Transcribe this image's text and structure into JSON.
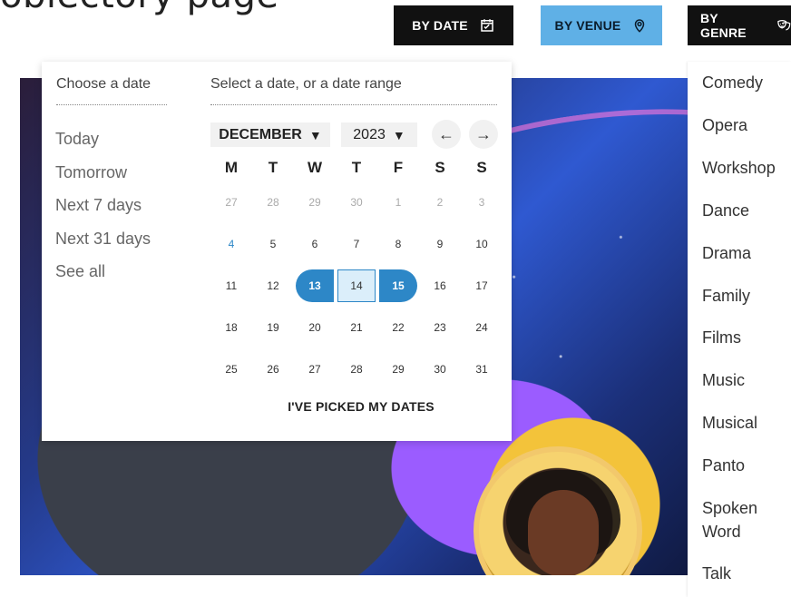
{
  "top_fragment": "oblectory page",
  "filters": {
    "date": {
      "label": "BY DATE",
      "icon": "calendar-icon"
    },
    "venue": {
      "label": "BY VENUE",
      "icon": "location-pin-icon"
    },
    "genre": {
      "label": "BY GENRE",
      "icon": "theatre-masks-icon"
    }
  },
  "date_picker": {
    "choose_title": "Choose a date",
    "select_title": "Select a date, or a date range",
    "quick_options": [
      "Today",
      "Tomorrow",
      "Next 7 days",
      "Next 31 days",
      "See all"
    ],
    "month": "DECEMBER",
    "year": "2023",
    "nav": {
      "prev": "←",
      "next": "→"
    },
    "weekdays": [
      "M",
      "T",
      "W",
      "T",
      "F",
      "S",
      "S"
    ],
    "weeks": [
      [
        {
          "d": "27",
          "s": "muted"
        },
        {
          "d": "28",
          "s": "muted"
        },
        {
          "d": "29",
          "s": "muted"
        },
        {
          "d": "30",
          "s": "muted"
        },
        {
          "d": "1",
          "s": "muted"
        },
        {
          "d": "2",
          "s": "muted"
        },
        {
          "d": "3",
          "s": "muted"
        }
      ],
      [
        {
          "d": "4",
          "s": "highlight"
        },
        {
          "d": "5",
          "s": ""
        },
        {
          "d": "6",
          "s": ""
        },
        {
          "d": "7",
          "s": ""
        },
        {
          "d": "8",
          "s": ""
        },
        {
          "d": "9",
          "s": ""
        },
        {
          "d": "10",
          "s": ""
        }
      ],
      [
        {
          "d": "11",
          "s": ""
        },
        {
          "d": "12",
          "s": ""
        },
        {
          "d": "13",
          "s": "start"
        },
        {
          "d": "14",
          "s": "inrange"
        },
        {
          "d": "15",
          "s": "end"
        },
        {
          "d": "16",
          "s": ""
        },
        {
          "d": "17",
          "s": ""
        }
      ],
      [
        {
          "d": "18",
          "s": ""
        },
        {
          "d": "19",
          "s": ""
        },
        {
          "d": "20",
          "s": ""
        },
        {
          "d": "21",
          "s": ""
        },
        {
          "d": "22",
          "s": ""
        },
        {
          "d": "23",
          "s": ""
        },
        {
          "d": "24",
          "s": ""
        }
      ],
      [
        {
          "d": "25",
          "s": ""
        },
        {
          "d": "26",
          "s": ""
        },
        {
          "d": "27",
          "s": ""
        },
        {
          "d": "28",
          "s": ""
        },
        {
          "d": "29",
          "s": ""
        },
        {
          "d": "30",
          "s": ""
        },
        {
          "d": "31",
          "s": ""
        }
      ]
    ],
    "picked_button": "I'VE PICKED MY DATES"
  },
  "genres": [
    "Comedy",
    "Opera",
    "Workshop",
    "Dance",
    "Drama",
    "Family",
    "Films",
    "Music",
    "Musical",
    "Panto",
    "Spoken Word",
    "Talk"
  ],
  "colors": {
    "accent_blue": "#2d87c7",
    "venue_button": "#5fb0e6",
    "button_black": "#111111"
  }
}
